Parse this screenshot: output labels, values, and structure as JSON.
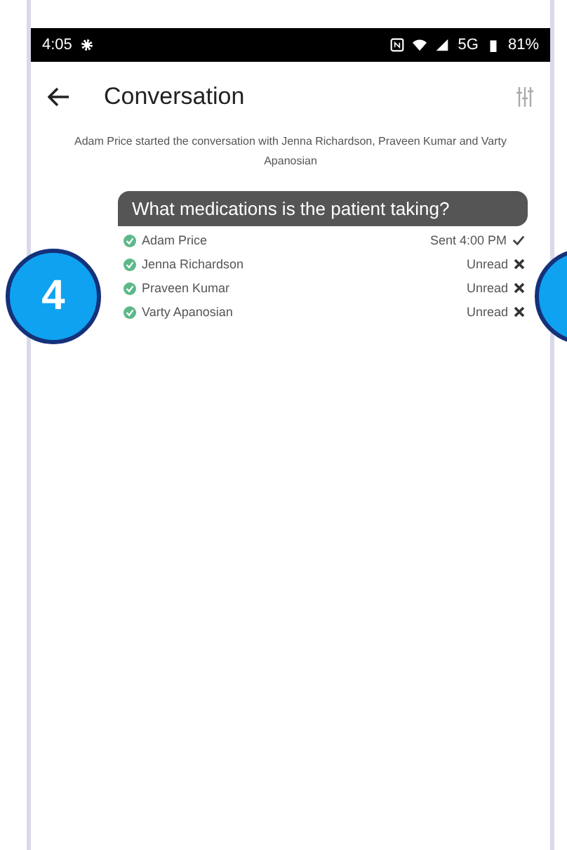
{
  "status_bar": {
    "time": "4:05",
    "network": "5G",
    "battery": "81%"
  },
  "header": {
    "title": "Conversation"
  },
  "system_note": "Adam Price started the conversation with Jenna Richardson, Praveen Kumar and Varty Apanosian",
  "message": {
    "text": "What medications is the patient taking?"
  },
  "recipients": [
    {
      "name": "Adam Price",
      "status": "Sent 4:00 PM",
      "kind": "sent"
    },
    {
      "name": "Jenna Richardson",
      "status": "Unread",
      "kind": "unread"
    },
    {
      "name": "Praveen Kumar",
      "status": "Unread",
      "kind": "unread"
    },
    {
      "name": "Varty Apanosian",
      "status": "Unread",
      "kind": "unread"
    }
  ],
  "callout": {
    "label": "4"
  }
}
